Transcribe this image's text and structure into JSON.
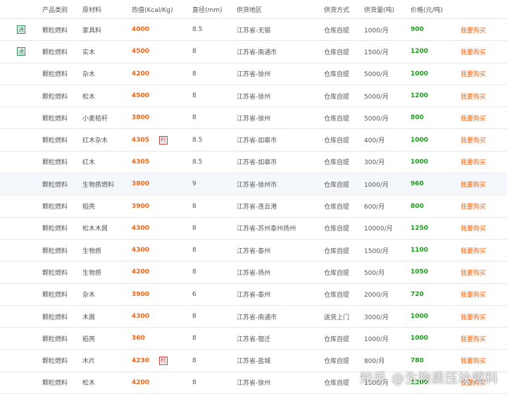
{
  "colors": {
    "heat": "#f06414",
    "price": "#1e9a1e",
    "buy": "#f06414",
    "badge": "#2e8b57",
    "tag": "#d23c3c"
  },
  "columns": [
    "产品类别",
    "原材料",
    "热值(Kcal/Kg)",
    "直径(mm)",
    "供货地区",
    "供货方式",
    "供货量(吨)",
    "价格(元/吨)"
  ],
  "rows": [
    {
      "badge": "通",
      "category": "颗粒燃料",
      "material": "家具料",
      "heat": "4000",
      "tag": "",
      "diameter": "8.5",
      "region": "江苏省-无锡",
      "method": "仓库自提",
      "supply": "1000/月",
      "price": "900",
      "action": "我要购买"
    },
    {
      "badge": "通",
      "category": "颗粒燃料",
      "material": "实木",
      "heat": "4500",
      "tag": "",
      "diameter": "8",
      "region": "江苏省-南通市",
      "method": "仓库自提",
      "supply": "1500/月",
      "price": "1200",
      "action": "我要购买"
    },
    {
      "badge": "",
      "category": "颗粒燃料",
      "material": "杂木",
      "heat": "4200",
      "tag": "",
      "diameter": "8",
      "region": "江苏省-徐州",
      "method": "仓库自提",
      "supply": "5000/月",
      "price": "1000",
      "action": "我要购买"
    },
    {
      "badge": "",
      "category": "颗粒燃料",
      "material": "松木",
      "heat": "4500",
      "tag": "",
      "diameter": "8",
      "region": "江苏省-徐州",
      "method": "仓库自提",
      "supply": "5000/月",
      "price": "1200",
      "action": "我要购买"
    },
    {
      "badge": "",
      "category": "颗粒燃料",
      "material": "小麦秸秆",
      "heat": "3800",
      "tag": "",
      "diameter": "8",
      "region": "江苏省-徐州",
      "method": "仓库自提",
      "supply": "5000/月",
      "price": "800",
      "action": "我要购买"
    },
    {
      "badge": "",
      "category": "颗粒燃料",
      "material": "红木杂木",
      "heat": "4305",
      "tag": "检",
      "diameter": "8.5",
      "region": "江苏省-如皋市",
      "method": "仓库自提",
      "supply": "400/月",
      "price": "1000",
      "action": "我要购买"
    },
    {
      "badge": "",
      "category": "颗粒燃料",
      "material": "红木",
      "heat": "4305",
      "tag": "",
      "diameter": "8.5",
      "region": "江苏省-如皋市",
      "method": "仓库自提",
      "supply": "300/月",
      "price": "1000",
      "action": "我要购买"
    },
    {
      "badge": "",
      "category": "颗粒燃料",
      "material": "生物质燃料",
      "heat": "3800",
      "tag": "",
      "diameter": "9",
      "region": "江苏省-徐州市",
      "method": "仓库自提",
      "supply": "1000/月",
      "price": "960",
      "action": "我要购买"
    },
    {
      "badge": "",
      "category": "颗粒燃料",
      "material": "稻壳",
      "heat": "3900",
      "tag": "",
      "diameter": "8",
      "region": "江苏省-连云港",
      "method": "仓库自提",
      "supply": "600/月",
      "price": "800",
      "action": "我要购买"
    },
    {
      "badge": "",
      "category": "颗粒燃料",
      "material": "松木木屑",
      "heat": "4300",
      "tag": "",
      "diameter": "8",
      "region": "江苏省-苏州泰州扬州",
      "method": "仓库自提",
      "supply": "10000/月",
      "price": "1250",
      "action": "我要购买"
    },
    {
      "badge": "",
      "category": "颗粒燃料",
      "material": "生物质",
      "heat": "4300",
      "tag": "",
      "diameter": "8",
      "region": "江苏省-泰州",
      "method": "仓库自提",
      "supply": "1500/月",
      "price": "1100",
      "action": "我要购买"
    },
    {
      "badge": "",
      "category": "颗粒燃料",
      "material": "生物质",
      "heat": "4200",
      "tag": "",
      "diameter": "8",
      "region": "江苏省-扬州",
      "method": "仓库自提",
      "supply": "500/月",
      "price": "1050",
      "action": "我要购买"
    },
    {
      "badge": "",
      "category": "颗粒燃料",
      "material": "杂木",
      "heat": "3900",
      "tag": "",
      "diameter": "6",
      "region": "江苏省-泰州",
      "method": "仓库自提",
      "supply": "2000/月",
      "price": "720",
      "action": "我要购买"
    },
    {
      "badge": "",
      "category": "颗粒燃料",
      "material": "木屑",
      "heat": "4300",
      "tag": "",
      "diameter": "8",
      "region": "江苏省-南通市",
      "method": "送货上门",
      "supply": "3000/月",
      "price": "1000",
      "action": "我要购买"
    },
    {
      "badge": "",
      "category": "颗粒燃料",
      "material": "稻壳",
      "heat": "360",
      "tag": "",
      "diameter": "8",
      "region": "江苏省-宿迁",
      "method": "仓库自提",
      "supply": "1000/月",
      "price": "1000",
      "action": "我要购买"
    },
    {
      "badge": "",
      "category": "颗粒燃料",
      "material": "木片",
      "heat": "4230",
      "tag": "检",
      "diameter": "8",
      "region": "江苏省-盐城",
      "method": "仓库自提",
      "supply": "800/月",
      "price": "780",
      "action": "我要购买"
    },
    {
      "badge": "",
      "category": "颗粒燃料",
      "material": "松木",
      "heat": "4200",
      "tag": "",
      "diameter": "8",
      "region": "江苏省-徐州",
      "method": "仓库自提",
      "supply": "1500/月",
      "price": "1200",
      "action": "我要购买"
    }
  ],
  "watermark": "知乎 @生物质压块燃料"
}
